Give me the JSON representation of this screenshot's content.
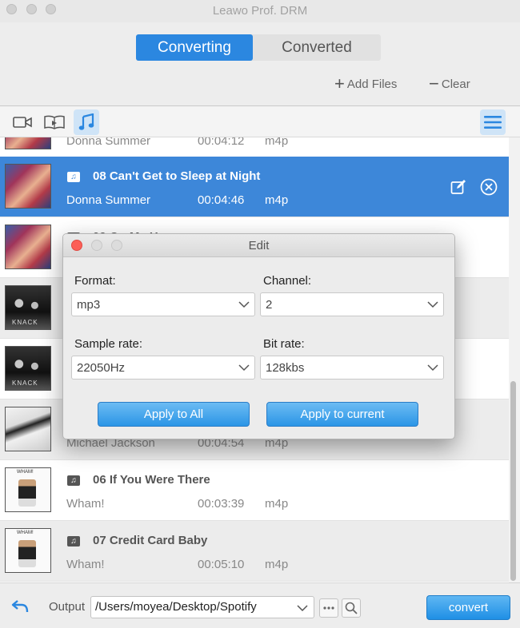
{
  "window": {
    "title": "Leawo Prof. DRM"
  },
  "tabs": {
    "converting": "Converting",
    "converted": "Converted"
  },
  "header": {
    "add_files": "Add Files",
    "clear": "Clear"
  },
  "toolbar": {
    "icons": [
      "video-icon",
      "book-icon",
      "music-note-icon"
    ],
    "active": "music-note-icon",
    "menu_icon": "hamburger-menu-icon"
  },
  "tracks": [
    {
      "title": "",
      "artist": "Donna Summer",
      "duration": "00:04:12",
      "format": "m4p",
      "cover": "donna-summer-cover"
    },
    {
      "title": "08 Can't Get to Sleep at Night",
      "artist": "Donna Summer",
      "duration": "00:04:46",
      "format": "m4p",
      "cover": "donna-summer-cover",
      "selected": true
    },
    {
      "title": "09 On My Honor",
      "artist": "",
      "duration": "",
      "format": "",
      "cover": "donna-summer-cover"
    },
    {
      "title": "",
      "artist": "",
      "duration": "",
      "format": "",
      "cover": "the-knack-cover"
    },
    {
      "title": "",
      "artist": "",
      "duration": "",
      "format": "",
      "cover": "the-knack-cover"
    },
    {
      "title": "",
      "artist": "Michael Jackson",
      "duration": "00:04:54",
      "format": "m4p",
      "cover": "michael-jackson-cover"
    },
    {
      "title": "06 If You Were There",
      "artist": "Wham!",
      "duration": "00:03:39",
      "format": "m4p",
      "cover": "wham-cover"
    },
    {
      "title": "07 Credit Card Baby",
      "artist": "Wham!",
      "duration": "00:05:10",
      "format": "m4p",
      "cover": "wham-cover"
    }
  ],
  "cover_text": {
    "knack": "KNACK",
    "wham": "WHAM!"
  },
  "edit_dialog": {
    "title": "Edit",
    "format_label": "Format:",
    "format_value": "mp3",
    "channel_label": "Channel:",
    "channel_value": "2",
    "sample_rate_label": "Sample rate:",
    "sample_rate_value": "22050Hz",
    "bit_rate_label": "Bit rate:",
    "bit_rate_value": "128kbs",
    "apply_all": "Apply to All",
    "apply_current": "Apply to current"
  },
  "bottom": {
    "output_label": "Output",
    "output_path": "/Users/moyea/Desktop/Spotify",
    "convert": "convert"
  },
  "colors": {
    "accent": "#2b87e0",
    "selected_row": "#3d87d9",
    "close_red": "#fc5f57"
  }
}
